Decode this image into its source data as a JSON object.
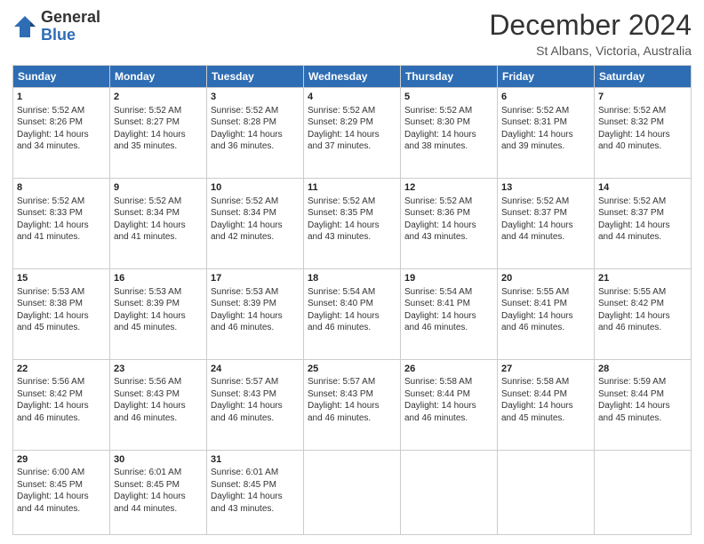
{
  "logo": {
    "general": "General",
    "blue": "Blue"
  },
  "header": {
    "month": "December 2024",
    "location": "St Albans, Victoria, Australia"
  },
  "weekdays": [
    "Sunday",
    "Monday",
    "Tuesday",
    "Wednesday",
    "Thursday",
    "Friday",
    "Saturday"
  ],
  "weeks": [
    [
      {
        "day": "1",
        "sunrise": "5:52 AM",
        "sunset": "8:26 PM",
        "daylight": "14 hours and 34 minutes."
      },
      {
        "day": "2",
        "sunrise": "5:52 AM",
        "sunset": "8:27 PM",
        "daylight": "14 hours and 35 minutes."
      },
      {
        "day": "3",
        "sunrise": "5:52 AM",
        "sunset": "8:28 PM",
        "daylight": "14 hours and 36 minutes."
      },
      {
        "day": "4",
        "sunrise": "5:52 AM",
        "sunset": "8:29 PM",
        "daylight": "14 hours and 37 minutes."
      },
      {
        "day": "5",
        "sunrise": "5:52 AM",
        "sunset": "8:30 PM",
        "daylight": "14 hours and 38 minutes."
      },
      {
        "day": "6",
        "sunrise": "5:52 AM",
        "sunset": "8:31 PM",
        "daylight": "14 hours and 39 minutes."
      },
      {
        "day": "7",
        "sunrise": "5:52 AM",
        "sunset": "8:32 PM",
        "daylight": "14 hours and 40 minutes."
      }
    ],
    [
      {
        "day": "8",
        "sunrise": "5:52 AM",
        "sunset": "8:33 PM",
        "daylight": "14 hours and 41 minutes."
      },
      {
        "day": "9",
        "sunrise": "5:52 AM",
        "sunset": "8:34 PM",
        "daylight": "14 hours and 41 minutes."
      },
      {
        "day": "10",
        "sunrise": "5:52 AM",
        "sunset": "8:34 PM",
        "daylight": "14 hours and 42 minutes."
      },
      {
        "day": "11",
        "sunrise": "5:52 AM",
        "sunset": "8:35 PM",
        "daylight": "14 hours and 43 minutes."
      },
      {
        "day": "12",
        "sunrise": "5:52 AM",
        "sunset": "8:36 PM",
        "daylight": "14 hours and 43 minutes."
      },
      {
        "day": "13",
        "sunrise": "5:52 AM",
        "sunset": "8:37 PM",
        "daylight": "14 hours and 44 minutes."
      },
      {
        "day": "14",
        "sunrise": "5:52 AM",
        "sunset": "8:37 PM",
        "daylight": "14 hours and 44 minutes."
      }
    ],
    [
      {
        "day": "15",
        "sunrise": "5:53 AM",
        "sunset": "8:38 PM",
        "daylight": "14 hours and 45 minutes."
      },
      {
        "day": "16",
        "sunrise": "5:53 AM",
        "sunset": "8:39 PM",
        "daylight": "14 hours and 45 minutes."
      },
      {
        "day": "17",
        "sunrise": "5:53 AM",
        "sunset": "8:39 PM",
        "daylight": "14 hours and 46 minutes."
      },
      {
        "day": "18",
        "sunrise": "5:54 AM",
        "sunset": "8:40 PM",
        "daylight": "14 hours and 46 minutes."
      },
      {
        "day": "19",
        "sunrise": "5:54 AM",
        "sunset": "8:41 PM",
        "daylight": "14 hours and 46 minutes."
      },
      {
        "day": "20",
        "sunrise": "5:55 AM",
        "sunset": "8:41 PM",
        "daylight": "14 hours and 46 minutes."
      },
      {
        "day": "21",
        "sunrise": "5:55 AM",
        "sunset": "8:42 PM",
        "daylight": "14 hours and 46 minutes."
      }
    ],
    [
      {
        "day": "22",
        "sunrise": "5:56 AM",
        "sunset": "8:42 PM",
        "daylight": "14 hours and 46 minutes."
      },
      {
        "day": "23",
        "sunrise": "5:56 AM",
        "sunset": "8:43 PM",
        "daylight": "14 hours and 46 minutes."
      },
      {
        "day": "24",
        "sunrise": "5:57 AM",
        "sunset": "8:43 PM",
        "daylight": "14 hours and 46 minutes."
      },
      {
        "day": "25",
        "sunrise": "5:57 AM",
        "sunset": "8:43 PM",
        "daylight": "14 hours and 46 minutes."
      },
      {
        "day": "26",
        "sunrise": "5:58 AM",
        "sunset": "8:44 PM",
        "daylight": "14 hours and 46 minutes."
      },
      {
        "day": "27",
        "sunrise": "5:58 AM",
        "sunset": "8:44 PM",
        "daylight": "14 hours and 45 minutes."
      },
      {
        "day": "28",
        "sunrise": "5:59 AM",
        "sunset": "8:44 PM",
        "daylight": "14 hours and 45 minutes."
      }
    ],
    [
      {
        "day": "29",
        "sunrise": "6:00 AM",
        "sunset": "8:45 PM",
        "daylight": "14 hours and 44 minutes."
      },
      {
        "day": "30",
        "sunrise": "6:01 AM",
        "sunset": "8:45 PM",
        "daylight": "14 hours and 44 minutes."
      },
      {
        "day": "31",
        "sunrise": "6:01 AM",
        "sunset": "8:45 PM",
        "daylight": "14 hours and 43 minutes."
      },
      null,
      null,
      null,
      null
    ]
  ]
}
